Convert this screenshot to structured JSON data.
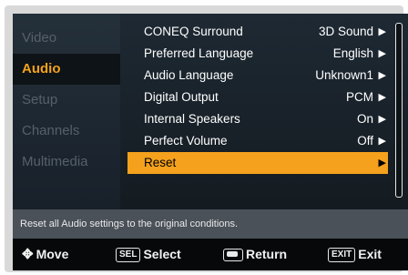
{
  "sidebar": {
    "items": [
      {
        "label": "Video",
        "active": false
      },
      {
        "label": "Audio",
        "active": true
      },
      {
        "label": "Setup",
        "active": false
      },
      {
        "label": "Channels",
        "active": false
      },
      {
        "label": "Multimedia",
        "active": false
      }
    ]
  },
  "menu": {
    "items": [
      {
        "label": "CONEQ Surround",
        "value": "3D Sound",
        "arrow": "▶"
      },
      {
        "label": "Preferred Language",
        "value": "English",
        "arrow": "▶"
      },
      {
        "label": "Audio Language",
        "value": "Unknown1",
        "arrow": "▶"
      },
      {
        "label": "Digital Output",
        "value": "PCM",
        "arrow": "▶"
      },
      {
        "label": "Internal Speakers",
        "value": "On",
        "arrow": "▶"
      },
      {
        "label": "Perfect Volume",
        "value": "Off",
        "arrow": "▶"
      },
      {
        "label": "Reset",
        "value": "",
        "arrow": "▶"
      }
    ],
    "selected_index": 6
  },
  "description": "Reset all Audio settings to the original conditions.",
  "footer": {
    "move": {
      "icon": "move-arrows-icon",
      "glyph": "✥",
      "label": "Move"
    },
    "select": {
      "key": "SEL",
      "label": "Select"
    },
    "return": {
      "icon": "return-key-icon",
      "label": "Return"
    },
    "exit": {
      "key": "EXIT",
      "label": "Exit"
    }
  },
  "colors": {
    "accent": "#f5a11d",
    "active_text": "#f3a21c",
    "inactive_text": "#56606a",
    "description_bg": "#4a5158",
    "footer_bg": "#06080a"
  }
}
